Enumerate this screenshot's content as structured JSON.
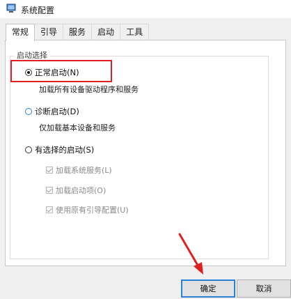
{
  "window": {
    "title": "系统配置"
  },
  "tabs": [
    {
      "label": "常规",
      "active": true
    },
    {
      "label": "引导",
      "active": false
    },
    {
      "label": "服务",
      "active": false
    },
    {
      "label": "启动",
      "active": false
    },
    {
      "label": "工具",
      "active": false
    }
  ],
  "startup": {
    "group_title": "启动选择",
    "normal": {
      "label": "正常启动(N)",
      "checked": true,
      "description": "加载所有设备驱动程序和服务"
    },
    "diagnostic": {
      "label": "诊断启动(D)",
      "checked": false,
      "description": "仅加载基本设备和服务"
    },
    "selective": {
      "label": "有选择的启动(S)",
      "checked": false,
      "options": [
        {
          "label": "加载系统服务(L)",
          "checked": true,
          "disabled": true
        },
        {
          "label": "加载启动项(O)",
          "checked": true,
          "disabled": true
        },
        {
          "label": "使用原有引导配置(U)",
          "checked": true,
          "disabled": true
        }
      ]
    }
  },
  "buttons": {
    "ok": "确定",
    "cancel": "取消"
  },
  "colors": {
    "highlight": "#e02020",
    "accent": "#2a7fd6"
  }
}
